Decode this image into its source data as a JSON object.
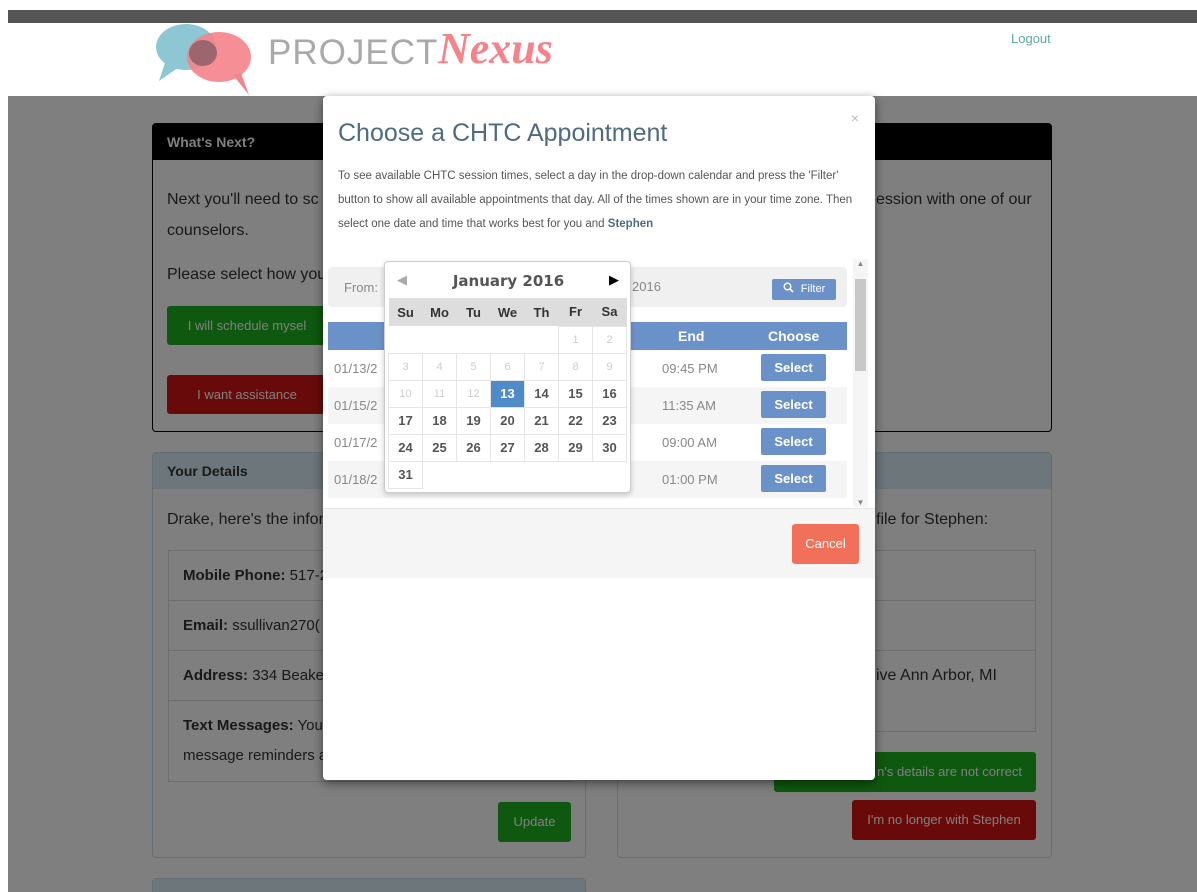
{
  "header": {
    "logo_word1": "PROJECT",
    "logo_word2": "Nexus",
    "logout": "Logout"
  },
  "whats_next": {
    "title": "What's Next?",
    "text1_left": "Next you'll need to sc",
    "text1_right": "ession with one of our",
    "text1_line2": "counselors.",
    "text2": "Please select how you",
    "btn_schedule": "I will schedule mysel",
    "btn_assist": "I want assistance"
  },
  "your_details": {
    "title": "Your Details",
    "intro": "Drake, here's the infor",
    "mobile_label": "Mobile Phone:",
    "mobile_value": "517-2",
    "email_label": "Email:",
    "email_value": "ssullivan270(",
    "address_label": "Address:",
    "address_value": "334 Beakes",
    "text_label": "Text Messages:",
    "text_value": "You",
    "text_line2": "message reminders a",
    "update": "Update"
  },
  "partner": {
    "intro_right": "file for Stephen:",
    "address_right": "ive Ann Arbor, MI",
    "btn_incorrect": "n's details are not correct",
    "btn_nolonger": "I'm no longer with Stephen"
  },
  "modal": {
    "close": "×",
    "title": "Choose a CHTC Appointment",
    "desc_pre": "To see available CHTC session times, select a day in the drop-down calendar and press the 'Filter' button to show all available appointments that day. All of the times shown are in your time zone. Then select one date and time that works best for you and ",
    "desc_name": "Stephen",
    "from_label": "From:",
    "to_date_partial": "2016",
    "filter": "Filter",
    "col_end": "End",
    "col_choose": "Choose",
    "rows": [
      {
        "date": "01/13/2",
        "end": "09:45 PM",
        "action": "Select"
      },
      {
        "date": "01/15/2",
        "end": "11:35 AM",
        "action": "Select"
      },
      {
        "date": "01/17/2",
        "end": "09:00 AM",
        "action": "Select"
      },
      {
        "date": "01/18/2",
        "end": "01:00 PM",
        "action": "Select"
      }
    ],
    "cancel": "Cancel"
  },
  "calendar": {
    "month": "January 2016",
    "weekdays": [
      "Su",
      "Mo",
      "Tu",
      "We",
      "Th",
      "Fr",
      "Sa"
    ],
    "selected_day": "13"
  }
}
